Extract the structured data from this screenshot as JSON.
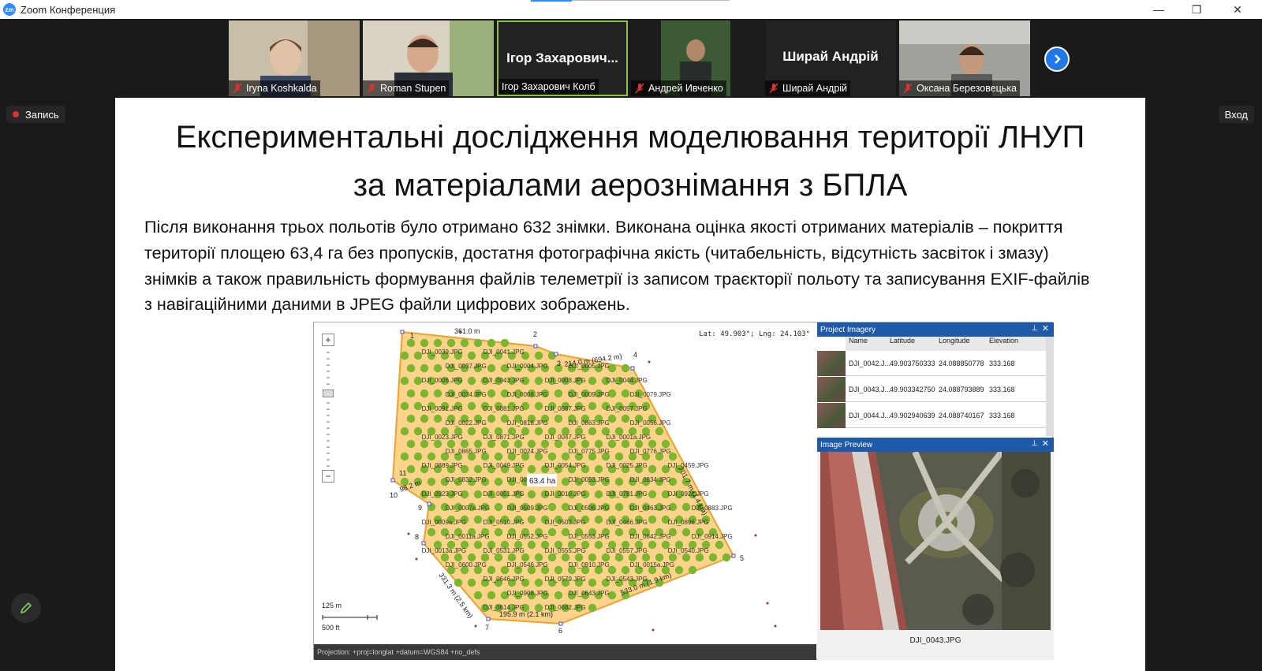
{
  "window": {
    "app_title": "Zoom Конференция",
    "minimize": "—",
    "restore": "❐",
    "close": "✕"
  },
  "participants": [
    {
      "name": "Iryna Koshkalda",
      "muted": true,
      "video": true
    },
    {
      "name": "Roman Stupen",
      "muted": true,
      "video": true
    },
    {
      "name": "Ігор Захарович Колб",
      "display": "Ігор Захарович...",
      "muted": false,
      "video": false,
      "active": true
    },
    {
      "name": "Андрей Ивченко",
      "muted": true,
      "video": true
    },
    {
      "name": "Ширай Андрій",
      "display": "Ширай Андрій",
      "muted": true,
      "video": false
    },
    {
      "name": "Оксана Березовецька",
      "muted": true,
      "video": true
    }
  ],
  "controls": {
    "record_label": "Запись",
    "enter_label": "Вход"
  },
  "slide": {
    "title_line1": "Експериментальні дослідження моделювання території ЛНУП",
    "title_line2": "за матеріалами аерознімання з БПЛА",
    "body": "Після виконання трьох польотів було отримано 632 знімки. Виконана оцінка якості отриманих матеріалів – покриття території площею 63,4 га без пропусків, достатня фотографічна якість (читабельність, відсутність засвіток і змазу) знімків а також правильність формування файлів телеметрії із записом траєкторії польоту та записування EXIF-файлів з навігаційними даними в JPEG файли цифрових зображень."
  },
  "figure": {
    "latlng": "Lat: 49.903°; Lng: 24.103°",
    "projection": "Projection: +proj=longlat +datum=WGS84 +no_defs",
    "area_label": "63.4 ha",
    "scale_m": "125 m",
    "scale_ft": "500 ft",
    "zoom_plus": "+",
    "zoom_minus": "−",
    "edge_labels": [
      {
        "text": "361.0 m"
      },
      {
        "text": "214.0 m (694.2 m)"
      },
      {
        "text": "701.7 m (1.4 km)"
      },
      {
        "text": "533.0 m (1.9 km)"
      },
      {
        "text": "195.9 m (2.1 km)"
      },
      {
        "text": "331.3 m (2.5 km)"
      },
      {
        "text": "98.2 m"
      }
    ],
    "vertex_labels": [
      "1",
      "2",
      "3",
      "4",
      "5",
      "6",
      "7",
      "8",
      "9",
      "10",
      "11"
    ],
    "photo_labels": [
      "DJI_0039.JPG",
      "DJI_0041.JPG",
      "DJI_0037.JPG",
      "DJI_0004.JPG",
      "DJI_0005.JPG",
      "DJI_0006.JPG",
      "DJI_0043.JPG",
      "DJI_0003.JPG",
      "DJI_0044.JPG",
      "DJI_0034.JPG",
      "DJI_0008.JPG",
      "DJI_0009.JPG",
      "DJI_0079.JPG",
      "DJI_0091.JPG",
      "DJI_0081.JPG",
      "DJI_0087.JPG",
      "DJI_0057.JPG",
      "DJI_0022.JPG",
      "DJI_0818.JPG",
      "DJI_0863.JPG",
      "DJI_0056.JPG",
      "DJI_0023.JPG",
      "DJI_0871.JPG",
      "DJI_0047.JPG",
      "DJI_0001a.JPG",
      "DJI_0865.JPG",
      "DJI_0024.JPG",
      "DJI_0775.JPG",
      "DJI_0776.JPG",
      "DJI_0889.JPG",
      "DJI_0049.JPG",
      "DJI_0054.JPG",
      "DJI_0025.JPG",
      "DJI_0459.JPG",
      "DJI_0832.JPG",
      "DJI_0025.JPG",
      "DJI_0053.JPG",
      "DJI_0834.JPG",
      "DJI_0923.JPG",
      "DJI_0051.JPG",
      "DJI_0010.JPG",
      "DJI_0781.JPG",
      "DJI_0921.JPG",
      "DJI_0007a.JPG",
      "DJI_0509.JPG",
      "DJI_0506.JPG",
      "DJI_0463.JPG",
      "DJI_0883.JPG",
      "DJI_0009a.JPG",
      "DJI_0510.JPG",
      "DJI_0503.JPG",
      "DJI_0466.JPG",
      "DJI_0896.JPG",
      "DJI_0011a.JPG",
      "DJI_0552.JPG",
      "DJI_0553.JPG",
      "DJI_0842.JPG",
      "DJI_0914.JPG",
      "DJI_0013a.JPG",
      "DJI_0531.JPG",
      "DJI_0555.JPG",
      "DJI_0557.JPG",
      "DJI_0540.JPG",
      "DJI_0600.JPG",
      "DJI_0546.JPG",
      "DJI_0910.JPG",
      "DJI_0015a.JPG",
      "DJI_0646.JPG",
      "DJI_0579.JPG",
      "DJI_0543.JPG",
      "DJI_0908.JPG",
      "DJI_0643.JPG",
      "DJI_0614.JPG",
      "DJI_0682.JPG",
      "DJI_0652.JPG",
      "DJI_0630.JPG",
      "DJI_0634.JPG",
      "DJI_0655.JPG",
      "DJI_0620.JPG"
    ],
    "project_imagery": {
      "title": "Project Imagery",
      "columns": [
        "Name",
        "Latitude",
        "Longitude",
        "Elevation"
      ],
      "rows": [
        [
          "DJI_0042.J...",
          "49.903750333",
          "24.088850778",
          "333.168"
        ],
        [
          "DJI_0043.J...",
          "49.903342750",
          "24.088793889",
          "333.168"
        ],
        [
          "DJI_0044.J...",
          "49.902940639",
          "24.088740167",
          "333.168"
        ]
      ]
    },
    "image_preview": {
      "title": "Image Preview",
      "filename": "DJI_0043.JPG"
    }
  },
  "colors": {
    "zoom_blue": "#2d8cff",
    "area_fill": "#fbd38a",
    "area_border": "#f0a030",
    "dot_green": "#7cb62e",
    "record_red": "#e0312f",
    "active_border": "#8bc34a"
  }
}
